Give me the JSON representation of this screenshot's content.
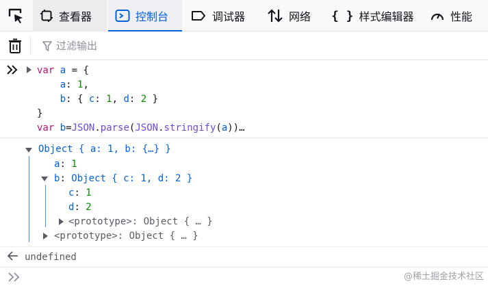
{
  "toolbar": {
    "tabs": [
      {
        "label": "查看器",
        "icon": "inspector-icon"
      },
      {
        "label": "控制台",
        "icon": "console-icon",
        "active": true
      },
      {
        "label": "调试器",
        "icon": "debugger-icon"
      },
      {
        "label": "网络",
        "icon": "network-icon"
      },
      {
        "label": "样式编辑器",
        "icon": "style-editor-icon"
      },
      {
        "label": "性能",
        "icon": "performance-icon"
      }
    ],
    "picker_icon": "element-picker-icon",
    "accent": "#0061e0"
  },
  "filter": {
    "placeholder": "过滤输出",
    "trash_icon": "trash-icon"
  },
  "console": {
    "input_lines": [
      "var a = {",
      "    a: 1,",
      "    b: { c: 1, d: 2 }",
      "}",
      "var b=JSON.parse(JSON.stringify(a))…"
    ],
    "tree": {
      "root": "Object { a: 1, b: {…} }",
      "a_key": "a",
      "a_val": "1",
      "b_key": "b",
      "b_obj": "Object { c: 1, d: 2 }",
      "c_key": "c",
      "c_val": "1",
      "d_key": "d",
      "d_val": "2",
      "inner_proto": "<prototype>: Object { … }",
      "outer_proto": "<prototype>: Object { … }"
    },
    "result": "undefined",
    "watermark": "@稀土掘金技术社区",
    "colors": {
      "keyword": "#b5137c",
      "property": "#0061e0",
      "number": "#058b00",
      "method": "#6b4ae2"
    }
  }
}
